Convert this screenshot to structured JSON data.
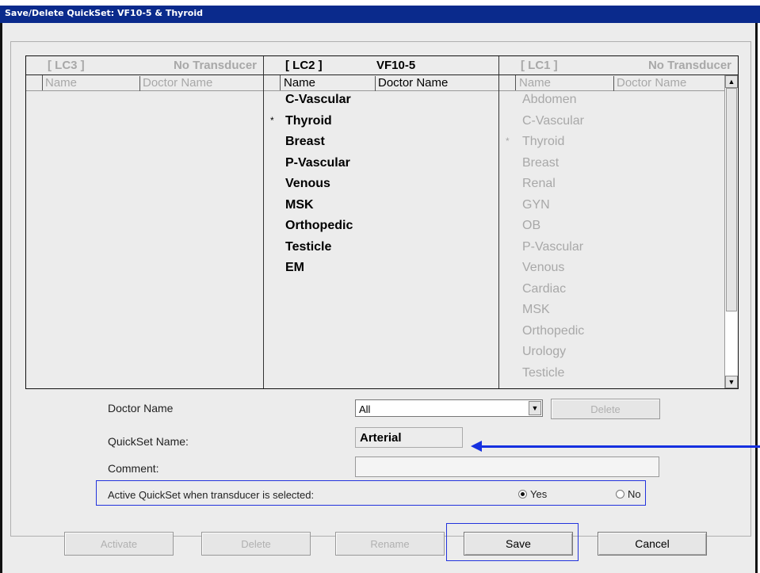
{
  "window": {
    "title": "Save/Delete QuickSet: VF10-5 & Thyroid"
  },
  "table": {
    "col1": {
      "slot": "[ LC3 ]",
      "transducer": "No Transducer",
      "name_header": "Name",
      "doc_header": "Doctor Name",
      "items": []
    },
    "col2": {
      "slot": "[ LC2 ]",
      "transducer": "VF10-5",
      "name_header": "Name",
      "doc_header": "Doctor Name",
      "items": [
        "C-Vascular",
        "Thyroid",
        "Breast",
        "P-Vascular",
        "Venous",
        "MSK",
        "Orthopedic",
        "Testicle",
        "EM"
      ],
      "star_item": "Thyroid",
      "star": "*"
    },
    "col3": {
      "slot": "[ LC1 ]",
      "transducer": "No Transducer",
      "name_header": "Name",
      "doc_header": "Doctor Name",
      "items": [
        "Abdomen",
        "C-Vascular",
        "Thyroid",
        "Breast",
        "Renal",
        "GYN",
        "OB",
        "P-Vascular",
        "Venous",
        "Cardiac",
        "MSK",
        "Orthopedic",
        "Urology",
        "Testicle"
      ],
      "star_item": "Thyroid",
      "star": "*"
    }
  },
  "form": {
    "doctor_label": "Doctor Name",
    "doctor_value": "All",
    "delete_label": "Delete",
    "quickset_label": "QuickSet Name:",
    "quickset_value": "Arterial",
    "comment_label": "Comment:",
    "comment_value": "",
    "active_label": "Active QuickSet when transducer is selected:",
    "yes_label": "Yes",
    "no_label": "No",
    "active_selected": "Yes"
  },
  "buttons": {
    "activate": "Activate",
    "delete": "Delete",
    "rename": "Rename",
    "save": "Save",
    "cancel": "Cancel"
  },
  "colors": {
    "title_bar": "#0a2a8c",
    "annotation": "#1530e0",
    "disabled_text": "#a8a8a8"
  }
}
